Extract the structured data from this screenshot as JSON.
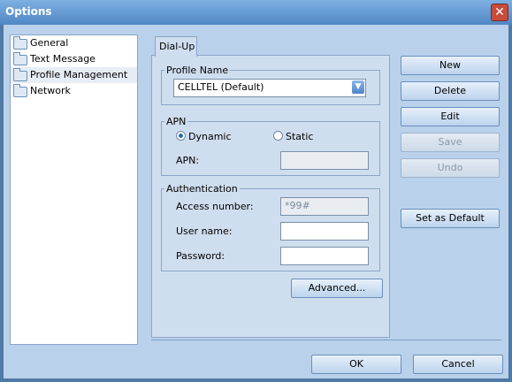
{
  "window": {
    "title": "Options",
    "close_glyph": "✕"
  },
  "sidebar": {
    "items": [
      {
        "label": "General",
        "icon": "folder-icon",
        "selected": false
      },
      {
        "label": "Text Message",
        "icon": "folder-icon",
        "selected": false
      },
      {
        "label": "Profile Management",
        "icon": "folder-icon",
        "selected": true
      },
      {
        "label": "Network",
        "icon": "folder-icon",
        "selected": false
      }
    ]
  },
  "tab": {
    "label": "Dial-Up"
  },
  "profile": {
    "legend": "Profile Name",
    "selected": "CELLTEL (Default)",
    "dropdown_glyph": "▼"
  },
  "apn": {
    "legend": "APN",
    "dynamic_label": "Dynamic",
    "static_label": "Static",
    "mode": "Dynamic",
    "apn_label": "APN:",
    "apn_value": ""
  },
  "auth": {
    "legend": "Authentication",
    "access_label": "Access number:",
    "access_value": "*99#",
    "user_label": "User name:",
    "user_value": "",
    "password_label": "Password:",
    "password_value": ""
  },
  "buttons": {
    "new": "New",
    "delete": "Delete",
    "edit": "Edit",
    "save": "Save",
    "undo": "Undo",
    "set_default": "Set as Default",
    "advanced": "Advanced...",
    "ok": "OK",
    "cancel": "Cancel"
  }
}
